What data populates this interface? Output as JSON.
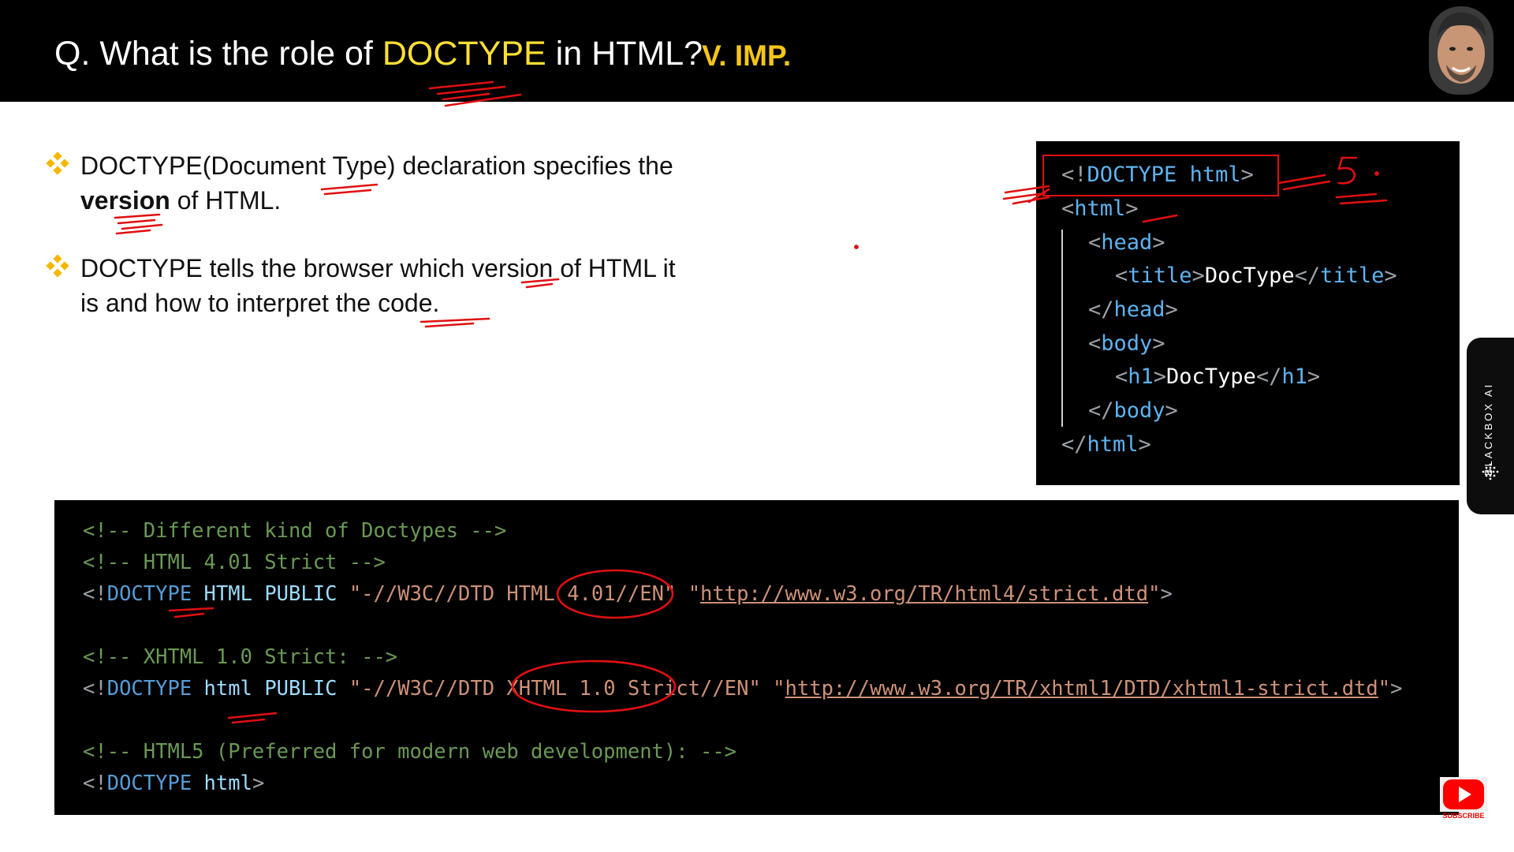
{
  "header": {
    "title_prefix": "Q. What is the role of ",
    "title_highlight": "DOCTYPE",
    "title_suffix": " in HTML?",
    "importance": "V. IMP."
  },
  "bullets": [
    {
      "text_a": "DOCTYPE(Document Type) declaration specifies the",
      "bold": "version",
      "text_b": " of HTML."
    },
    {
      "text_a": "DOCTYPE tells the browser which version of HTML it",
      "bold": "",
      "text_b": "is and how to interpret the code."
    }
  ],
  "code_example": {
    "doctype_open": "<!",
    "doctype_kw": "DOCTYPE",
    "doctype_attr": "html",
    "doctype_close": ">",
    "html_tag": "html",
    "head_tag": "head",
    "title_tag": "title",
    "title_text": "DocType",
    "h1_tag": "h1",
    "h1_text": "DocType",
    "body_tag": "body"
  },
  "doctypes_code": {
    "c1": "<!-- Different kind of Doctypes -->",
    "c2": "<!-- HTML 4.01 Strict -->",
    "d1_kw": "DOCTYPE",
    "d1_name": "HTML",
    "d1_public": "PUBLIC",
    "d1_fpi": "\"-//W3C//DTD HTML 4.01//EN\"",
    "d1_url": "http://www.w3.org/TR/html4/strict.dtd",
    "c3": "<!-- XHTML 1.0 Strict: -->",
    "d2_kw": "DOCTYPE",
    "d2_name": "html",
    "d2_public": "PUBLIC",
    "d2_fpi": "\"-//W3C//DTD XHTML 1.0 Strict//EN\"",
    "d2_url": "http://www.w3.org/TR/xhtml1/DTD/xhtml1-strict.dtd",
    "c4": "<!-- HTML5 (Preferred for modern web development): -->",
    "d3_kw": "DOCTYPE",
    "d3_name": "html"
  },
  "annotation": {
    "number": "5."
  },
  "side_panel": {
    "label": "BLACKBOX AI"
  },
  "youtube": {
    "subscribe": "SUBSCRIBE"
  },
  "colors": {
    "highlight": "#ffe033",
    "importance": "#f5c518",
    "tag": "#5fb3f0",
    "comment": "#6a9955",
    "ink": "#e01010"
  }
}
